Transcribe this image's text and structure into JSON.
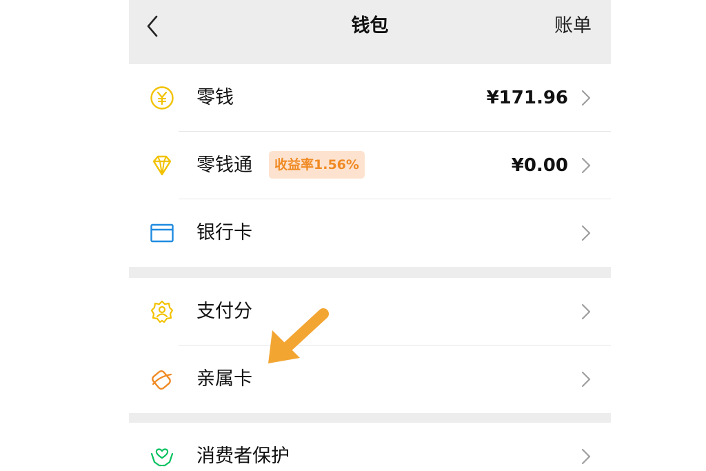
{
  "header": {
    "title": "钱包",
    "bill_label": "账单"
  },
  "groups": [
    {
      "items": [
        {
          "label": "零钱",
          "value": "¥171.96",
          "icon": "yuan-coin-icon"
        },
        {
          "label": "零钱通",
          "badge": "收益率1.56%",
          "value": "¥0.00",
          "icon": "diamond-icon"
        },
        {
          "label": "银行卡",
          "icon": "bank-card-icon"
        }
      ]
    },
    {
      "items": [
        {
          "label": "支付分",
          "icon": "pay-score-icon"
        },
        {
          "label": "亲属卡",
          "icon": "family-card-icon"
        }
      ]
    },
    {
      "items": [
        {
          "label": "消费者保护",
          "icon": "consumer-protection-icon"
        }
      ]
    }
  ],
  "colors": {
    "background": "#ededed",
    "yellow": "#f2c200",
    "blue": "#1f8be0",
    "orange": "#f08a24",
    "green": "#07c160",
    "annotation_arrow": "#f3a532"
  }
}
